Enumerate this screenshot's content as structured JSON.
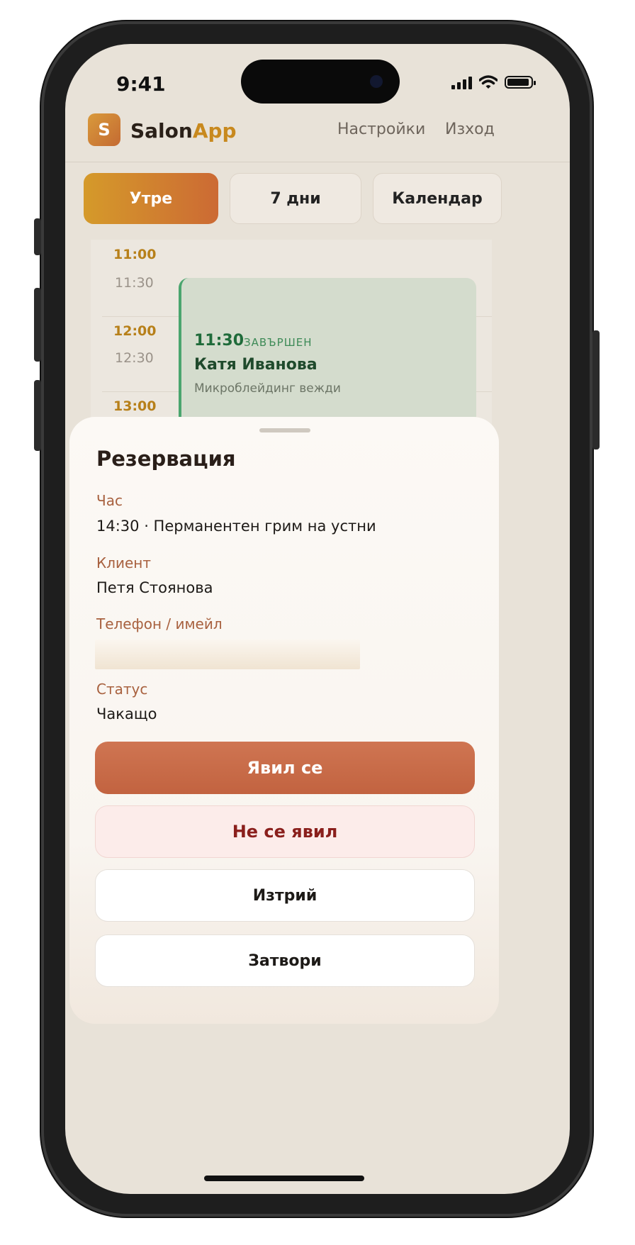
{
  "status_bar": {
    "time": "9:41"
  },
  "header": {
    "logo_letter": "S",
    "brand_main": "Salon",
    "brand_accent": "App",
    "nav": [
      "Настройки",
      "Изход"
    ]
  },
  "tabs": [
    {
      "label": "Утре",
      "active": true
    },
    {
      "label": "7 дни",
      "active": false
    },
    {
      "label": "Календар",
      "active": false
    }
  ],
  "schedule": {
    "times": [
      "11:00",
      "11:30",
      "12:00",
      "12:30",
      "13:00"
    ],
    "appointment": {
      "time": "11:30",
      "status": "ЗАВЪРШЕН",
      "client": "Катя Иванова",
      "service": "Микроблейдинг вежди"
    }
  },
  "sheet": {
    "title": "Резервация",
    "fields": {
      "time_label": "Час",
      "time_value": "14:30 · Перманентен грим на устни",
      "client_label": "Клиент",
      "client_value": "Петя Стоянова",
      "contact_label": "Телефон / имейл",
      "status_label": "Статус",
      "status_value": "Чакащо"
    },
    "buttons": {
      "arrived": "Явил се",
      "no_show": "Не се явил",
      "delete": "Изтрий",
      "close": "Затвори"
    }
  },
  "colors": {
    "accent": "#c8891e",
    "primary_button": "#c8694a",
    "completed_green": "#1f6b3a",
    "label": "#a8613f"
  }
}
